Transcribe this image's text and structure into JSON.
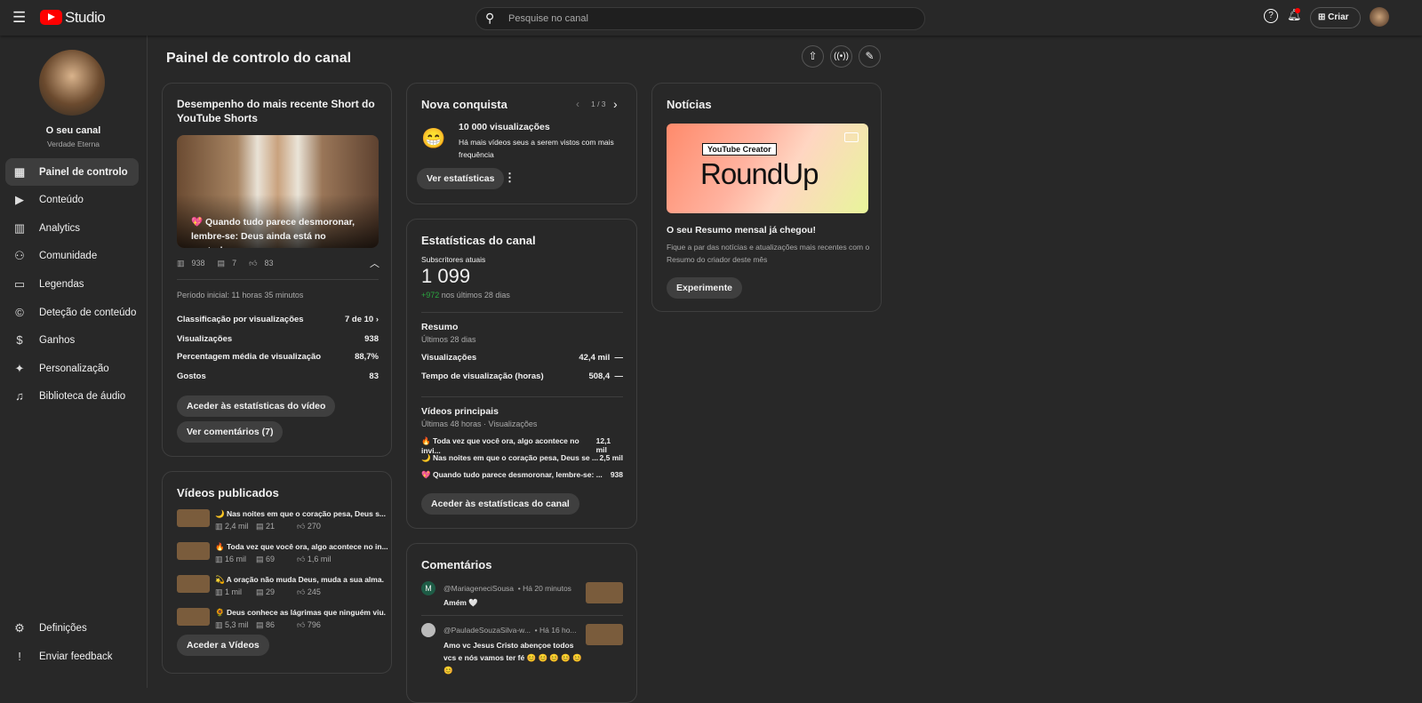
{
  "header": {
    "logo": "Studio",
    "search_placeholder": "Pesquise no canal",
    "create_label": "Criar"
  },
  "sidebar": {
    "channel_name": "O seu canal",
    "channel_handle": "Verdade Eterna",
    "items": [
      {
        "label": "Painel de controlo",
        "icon": "dashboard-icon"
      },
      {
        "label": "Conteúdo",
        "icon": "content-icon"
      },
      {
        "label": "Analytics",
        "icon": "analytics-icon"
      },
      {
        "label": "Comunidade",
        "icon": "community-icon"
      },
      {
        "label": "Legendas",
        "icon": "subtitles-icon"
      },
      {
        "label": "Deteção de conteúdo",
        "icon": "copyright-icon"
      },
      {
        "label": "Ganhos",
        "icon": "dollar-icon"
      },
      {
        "label": "Personalização",
        "icon": "magic-wand-icon"
      },
      {
        "label": "Biblioteca de áudio",
        "icon": "audio-library-icon"
      }
    ],
    "settings": "Definições",
    "feedback": "Enviar feedback"
  },
  "page_title": "Painel de controlo do canal",
  "short": {
    "title": "Desempenho do mais recente Short do YouTube Shorts",
    "caption_emoji": "💖",
    "caption": "Quando tudo parece desmoronar, lembre-se: Deus ainda está no controle.",
    "views": "938",
    "comments": "7",
    "likes": "83",
    "period": "Período inicial: 11 horas 35 minutos",
    "stats": [
      {
        "label": "Classificação por visualizações",
        "value": "7 de 10"
      },
      {
        "label": "Visualizações",
        "value": "938"
      },
      {
        "label": "Percentagem média de visualização",
        "value": "88,7%"
      },
      {
        "label": "Gostos",
        "value": "83"
      }
    ],
    "btn_stats": "Aceder às estatísticas do vídeo",
    "btn_comments": "Ver comentários (7)"
  },
  "published": {
    "title": "Vídeos publicados",
    "items": [
      {
        "emoji": "🌙",
        "title": "Nas noites em que o coração pesa, Deus s...",
        "views": "2,4 mil",
        "comments": "21",
        "likes": "270"
      },
      {
        "emoji": "🔥",
        "title": "Toda vez que você ora, algo acontece no in...",
        "views": "16 mil",
        "comments": "69",
        "likes": "1,6 mil"
      },
      {
        "emoji": "💫",
        "title": "A oração não muda Deus, muda a sua alma.",
        "views": "1 mil",
        "comments": "29",
        "likes": "245"
      },
      {
        "emoji": "🌻",
        "title": "Deus conhece as lágrimas que ninguém viu.",
        "views": "5,3 mil",
        "comments": "86",
        "likes": "796"
      }
    ],
    "button": "Aceder a Vídeos"
  },
  "achievement": {
    "title": "Nova conquista",
    "pager": "1 / 3",
    "emoji": "😁",
    "headline": "10 000 visualizações",
    "text": "Há mais vídeos seus a serem vistos com mais frequência",
    "button": "Ver estatísticas"
  },
  "channel_stats": {
    "title": "Estatísticas do canal",
    "subs_label": "Subscritores atuais",
    "subs": "1 099",
    "delta": "+972",
    "delta_text": "nos últimos 28 dias",
    "summary_title": "Resumo",
    "summary_period": "Últimos 28 dias",
    "summary": [
      {
        "label": "Visualizações",
        "value": "42,4 mil",
        "trend": "—"
      },
      {
        "label": "Tempo de visualização (horas)",
        "value": "508,4",
        "trend": "—"
      }
    ],
    "top_title": "Vídeos principais",
    "top_period": "Últimas 48 horas · Visualizações",
    "top": [
      {
        "emoji": "🔥",
        "title": "Toda vez que você ora, algo acontece no invi...",
        "value": "12,1 mil"
      },
      {
        "emoji": "🌙",
        "title": "Nas noites em que o coração pesa, Deus se ...",
        "value": "2,5 mil"
      },
      {
        "emoji": "💖",
        "title": "Quando tudo parece desmoronar, lembre-se: ...",
        "value": "938"
      }
    ],
    "button": "Aceder às estatísticas do canal"
  },
  "comments": {
    "title": "Comentários",
    "items": [
      {
        "avatar": "M",
        "author": "@MariageneciSousa",
        "time": "• Há 20 minutos",
        "text": "Amém 🤍"
      },
      {
        "avatar": "",
        "author": "@PauladeSouzaSilva-w...",
        "time": "• Há 16 ho...",
        "text": "Amo vc Jesus Cristo abençoe todos vcs e nós vamos ter fé 😊 😊 😊 😊 😊 😊"
      }
    ]
  },
  "news": {
    "title": "Notícias",
    "banner_tag": "YouTube Creator",
    "banner_title": "RoundUp",
    "headline": "O seu Resumo mensal já chegou!",
    "text": "Fique a par das notícias e atualizações mais recentes com o Resumo do criador deste mês",
    "button": "Experimente"
  },
  "colors": {
    "bg": "#282828",
    "accent_red": "#ff0000",
    "positive": "#2ba640"
  }
}
